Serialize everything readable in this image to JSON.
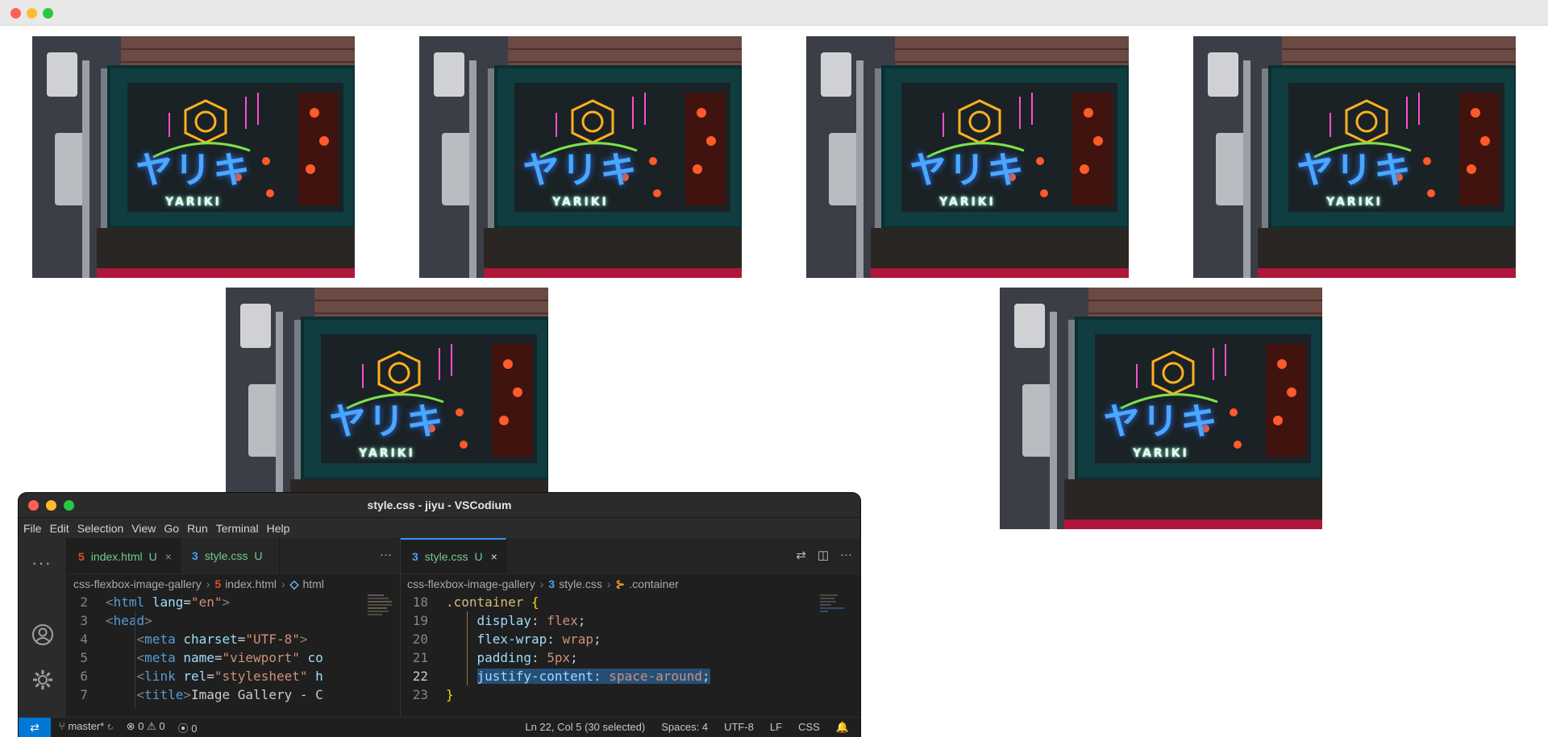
{
  "gallery": {
    "photos": [
      {
        "kana": "ヤリキ",
        "caption": "YARIKI"
      },
      {
        "kana": "ヤリキ",
        "caption": "YARIKI"
      },
      {
        "kana": "ヤリキ",
        "caption": "YARIKI"
      },
      {
        "kana": "ヤリキ",
        "caption": "YARIKI"
      },
      {
        "kana": "ヤリキ",
        "caption": "YARIKI"
      },
      {
        "kana": "ヤリキ",
        "caption": "YARIKI"
      }
    ]
  },
  "vscode": {
    "title": "style.css - jiyu - VSCodium",
    "menu": [
      "File",
      "Edit",
      "Selection",
      "View",
      "Go",
      "Run",
      "Terminal",
      "Help"
    ],
    "left_group": {
      "tabs": [
        {
          "icon": "5",
          "name": "index.html",
          "status": "U",
          "close": "×"
        },
        {
          "icon": "3",
          "name": "style.css",
          "status": "U"
        }
      ],
      "more": "···",
      "breadcrumb": [
        "css-flexbox-image-gallery",
        "index.html",
        "html"
      ],
      "lines": [
        {
          "n": "2"
        },
        {
          "n": "3"
        },
        {
          "n": "4"
        },
        {
          "n": "5"
        },
        {
          "n": "6"
        },
        {
          "n": "7"
        }
      ],
      "code": {
        "l2": {
          "open": "<",
          "tag": "html",
          "attr": "lang",
          "eq": "=",
          "val": "\"en\"",
          "close": ">"
        },
        "l3": {
          "open": "<",
          "tag": "head",
          "close": ">"
        },
        "l4": {
          "open": "<",
          "tag": "meta",
          "attr": "charset",
          "eq": "=",
          "val": "\"UTF-8\"",
          "close": ">"
        },
        "l5": {
          "open": "<",
          "tag": "meta",
          "attr": "name",
          "eq": "=",
          "val": "\"viewport\"",
          "tail": "co"
        },
        "l6": {
          "open": "<",
          "tag": "link",
          "attr": "rel",
          "eq": "=",
          "val": "\"stylesheet\"",
          "tail": "h"
        },
        "l7": {
          "open": "<",
          "tag": "title",
          "close": ">",
          "text": "Image Gallery - C"
        }
      }
    },
    "right_group": {
      "tab": {
        "icon": "3",
        "name": "style.css",
        "status": "U",
        "close": "×"
      },
      "breadcrumb": [
        "css-flexbox-image-gallery",
        "style.css",
        ".container"
      ],
      "lines": [
        {
          "n": "18"
        },
        {
          "n": "19"
        },
        {
          "n": "20"
        },
        {
          "n": "21"
        },
        {
          "n": "22"
        },
        {
          "n": "23"
        }
      ],
      "code": {
        "l18": {
          "sel": ".container",
          "brace": "{"
        },
        "l19": {
          "prop": "display",
          "colon": ":",
          "val": "flex",
          "semi": ";"
        },
        "l20": {
          "prop": "flex-wrap",
          "colon": ":",
          "val": "wrap",
          "semi": ";"
        },
        "l21": {
          "prop": "padding",
          "colon": ":",
          "val": "5px",
          "semi": ";"
        },
        "l22": {
          "prop": "justify-content",
          "colon": ":",
          "val": "space-around",
          "semi": ";"
        },
        "l23": {
          "brace": "}"
        }
      }
    },
    "status": {
      "branch": "master*",
      "errors": "0",
      "warnings": "0",
      "ports": "0",
      "position": "Ln 22, Col 5 (30 selected)",
      "spaces": "Spaces: 4",
      "encoding": "UTF-8",
      "eol": "LF",
      "language": "CSS"
    },
    "colors": {
      "accent": "#0078d4",
      "tab_active_border": "#3794ff",
      "untracked": "#73c991"
    }
  }
}
